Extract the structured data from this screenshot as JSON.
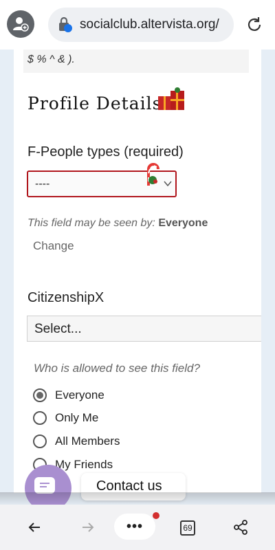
{
  "browser": {
    "url": "socialclub.altervista.org/",
    "tab_count": "69",
    "menu_label": "•••"
  },
  "form": {
    "hint_text": "$ % ^ & ).",
    "section_title": "Profile Details",
    "people_types_label": "F-People types (required)",
    "people_types_value": "----",
    "visibility_prefix": "This field may be seen by: ",
    "visibility_value": "Everyone",
    "change_label": "Change",
    "citizenship_label": "CitizenshipX",
    "citizenship_value": "Select...",
    "who_label": "Who is allowed to see this field?",
    "visibility_options": [
      {
        "label": "Everyone",
        "checked": true
      },
      {
        "label": "Only Me",
        "checked": false
      },
      {
        "label": "All Members",
        "checked": false
      },
      {
        "label": "My Friends",
        "checked": false
      }
    ]
  },
  "widget": {
    "contact_label": "Contact us"
  },
  "colors": {
    "error_border": "#b0151c",
    "chat_fab": "#a98fd0",
    "notification_dot": "#d32f2f"
  }
}
